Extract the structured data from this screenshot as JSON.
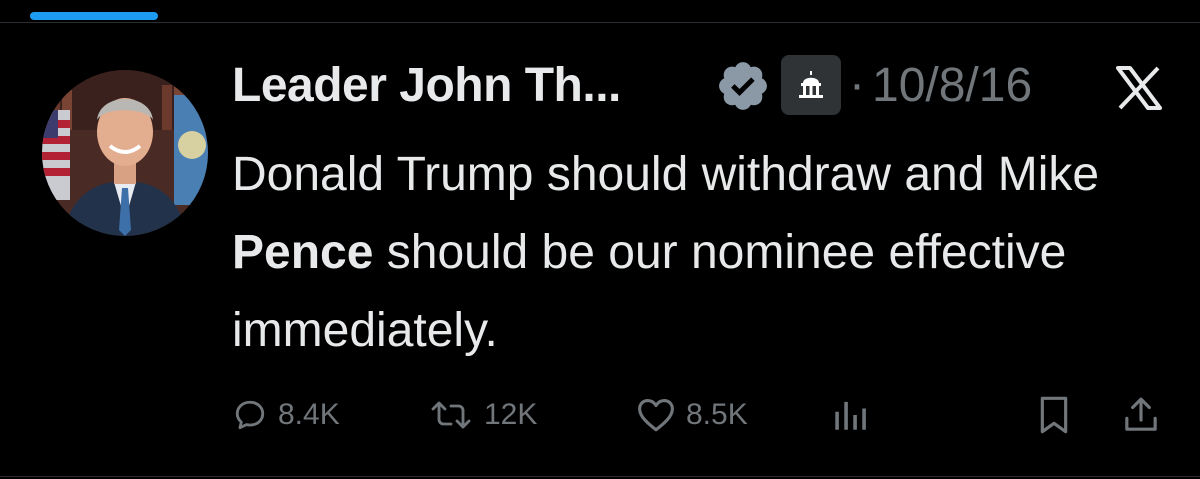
{
  "author": {
    "name": "Leader John Th...",
    "avatar_alt": "avatar",
    "verified_icon": "verified-badge-icon",
    "affiliation_icon": "capitol-building-icon"
  },
  "meta": {
    "separator": "·",
    "date": "10/8/16"
  },
  "tweet": {
    "text_part1": "Donald Trump should withdraw and Mike ",
    "text_bold": "Pence",
    "text_part2": " should be our nominee effective immediately."
  },
  "actions": {
    "replies": "8.4K",
    "retweets": "12K",
    "likes": "8.5K"
  },
  "colors": {
    "background": "#000000",
    "text_primary": "#e7e9ea",
    "text_secondary": "#71767b",
    "accent": "#1d9bf0"
  }
}
